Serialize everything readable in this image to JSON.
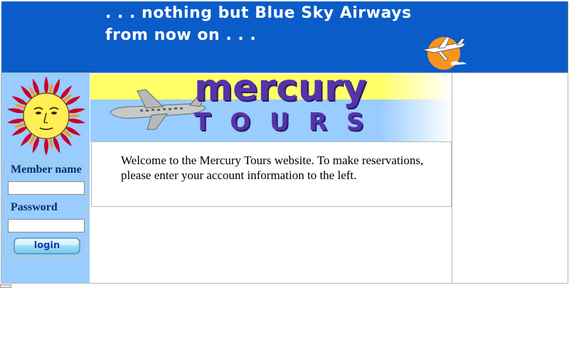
{
  "banner": {
    "line1": ". . . nothing but Blue Sky Airways",
    "line2": "from now on . . .",
    "background_color": "#0a5cc8",
    "logo_icon": "airplane-sun-logo-icon"
  },
  "hero": {
    "title": "mercury",
    "subtitle": "TOURS",
    "icon": "airplane-icon",
    "top_band_color": "#ffff66",
    "bottom_band_color": "#99ccff",
    "title_color": "#5533aa"
  },
  "sidebar": {
    "background_color": "#99ccff",
    "sun_icon": "sun-face-icon",
    "member_label": "Member name",
    "password_label": "Password",
    "username_value": "",
    "password_value": "",
    "login_label": "login"
  },
  "main": {
    "welcome_text": "Welcome to the Mercury Tours website. To make reservations, please enter your account information to the left."
  }
}
